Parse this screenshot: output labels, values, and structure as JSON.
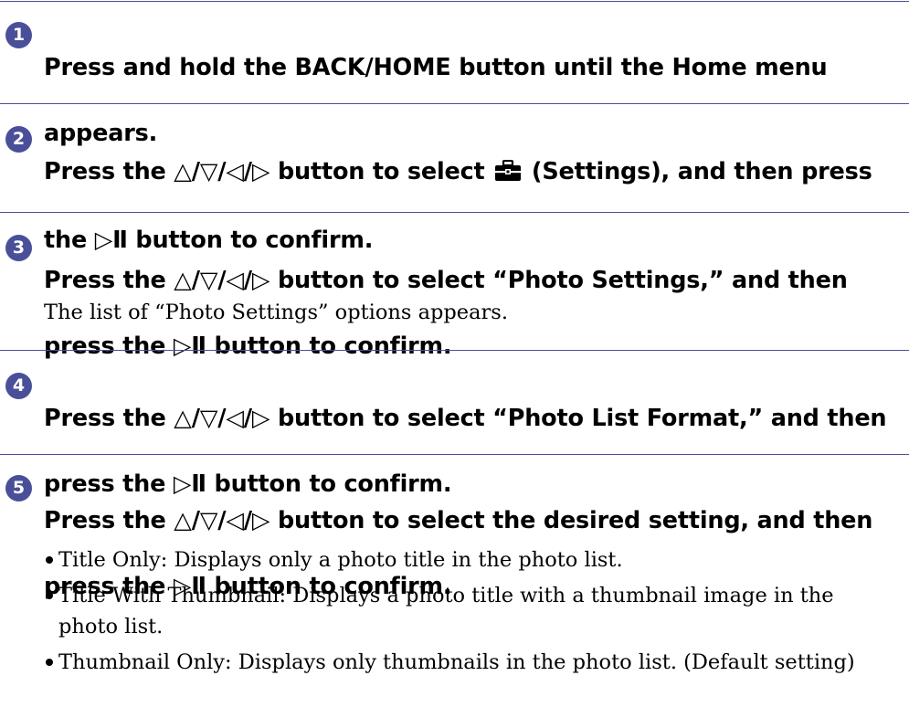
{
  "colors": {
    "accent": "#4a4f99",
    "text": "#000000"
  },
  "steps": [
    {
      "number": "1",
      "heading_lines": [
        "Press and hold the BACK/HOME button until the Home menu",
        "appears."
      ]
    },
    {
      "number": "2",
      "heading_line1_pre": "Press the △/▽/◁/▷ button to select ",
      "settings_icon": "toolbox-icon",
      "heading_line1_post": " (Settings), and then press",
      "heading_line2": "the ▷Ⅱ button to confirm."
    },
    {
      "number": "3",
      "heading_lines": [
        "Press the △/▽/◁/▷ button to select “Photo Settings,” and then",
        "press the ▷Ⅱ button to confirm."
      ],
      "body": "The list of “Photo Settings” options appears."
    },
    {
      "number": "4",
      "heading_lines": [
        "Press the △/▽/◁/▷ button to select “Photo List Format,” and then",
        "press the ▷Ⅱ button to confirm."
      ]
    },
    {
      "number": "5",
      "heading_lines": [
        "Press the △/▽/◁/▷ button to select the desired setting, and then",
        "press the ▷Ⅱ button to confirm."
      ],
      "options": [
        "Title Only: Displays only a photo title in the photo list.",
        "Title With Thumbnail: Displays a photo title with a thumbnail image in the photo list.",
        "Thumbnail Only: Displays only thumbnails in the photo list. (Default setting)"
      ]
    }
  ]
}
